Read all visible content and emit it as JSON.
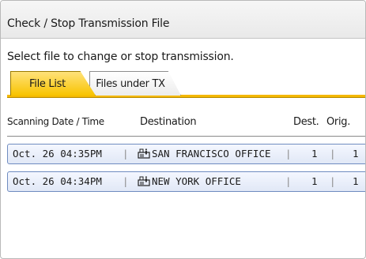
{
  "title": "Check / Stop Transmission File",
  "instruction": "Select file to change or stop transmission.",
  "tabs": [
    {
      "label": "File List",
      "selected": true
    },
    {
      "label": "Files under TX",
      "selected": false
    }
  ],
  "columns": {
    "date": "Scanning Date / Time",
    "destination": "Destination",
    "dest_count": "Dest.",
    "orig_count": "Orig."
  },
  "rows": [
    {
      "date": "Oct. 26 04:35PM",
      "destination": "SAN FRANCISCO OFFICE",
      "dest_count": "1",
      "orig_count": "1",
      "icon": "fax-icon"
    },
    {
      "date": "Oct. 26 04:34PM",
      "destination": "NEW YORK OFFICE",
      "dest_count": "1",
      "orig_count": "1",
      "icon": "fax-icon"
    }
  ],
  "colors": {
    "accent": "#f4b800",
    "row_border": "#6f8cc0"
  }
}
